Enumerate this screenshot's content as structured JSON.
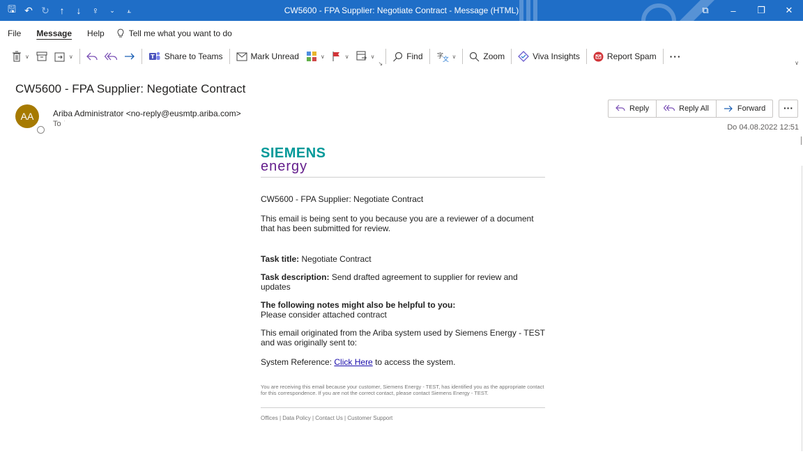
{
  "window": {
    "title": "CW5600 - FPA Supplier: Negotiate Contract  -  Message (HTML)"
  },
  "menu": {
    "items": [
      "File",
      "Message",
      "Help"
    ],
    "tell_me": "Tell me what you want to do"
  },
  "ribbon": {
    "share_teams": "Share to Teams",
    "mark_unread": "Mark Unread",
    "find": "Find",
    "zoom": "Zoom",
    "viva": "Viva Insights",
    "report_spam": "Report Spam"
  },
  "message": {
    "subject": "CW5600 - FPA Supplier: Negotiate Contract",
    "avatar_initials": "AA",
    "sender": "Ariba Administrator <no-reply@eusmtp.ariba.com>",
    "to_label": "To",
    "date": "Do 04.08.2022 12:51",
    "actions": {
      "reply": "Reply",
      "reply_all": "Reply All",
      "forward": "Forward",
      "more": "···"
    }
  },
  "body": {
    "logo_line1": "SIEMENS",
    "logo_line2": "energy",
    "heading": "CW5600 - FPA Supplier: Negotiate Contract",
    "intro": "This email is being sent to you because you are a reviewer of a document that has been submitted for review.",
    "task_title_label": "Task title:",
    "task_title": "Negotiate Contract",
    "task_desc_label": "Task description:",
    "task_desc": "Send drafted agreement to supplier for review and updates",
    "notes_label": "The following notes might also be helpful to you:",
    "notes": "Please consider attached contract",
    "origin": "This email originated from the Ariba system used by Siemens Energy - TEST and was originally sent to:",
    "sysref_label": "System Reference:",
    "sysref_link": "Click Here",
    "sysref_suffix": "to access the system.",
    "disclaimer": "You are receiving this email because your customer, Siemens Energy - TEST, has identified you as the appropriate contact for this correspondence. If you are not the correct contact, please contact Siemens Energy - TEST.",
    "footer": "Offices | Data Policy | Contact Us | Customer Support"
  },
  "colors": {
    "titlebar": "#1f6ec7",
    "avatar": "#a67a00",
    "siemens_teal": "#009999",
    "energy_purple": "#641e8c",
    "link": "#1a0dab",
    "spam_red": "#d13438"
  }
}
